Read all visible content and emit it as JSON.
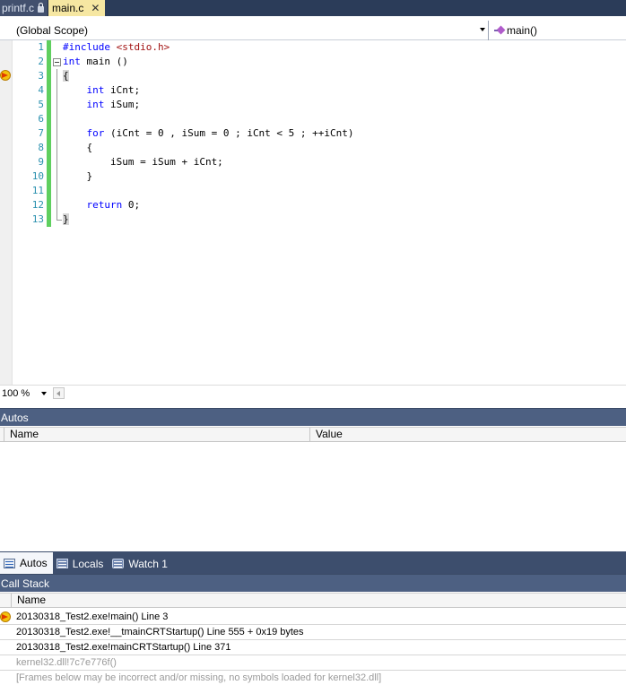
{
  "doc_tabs": [
    {
      "label": "printf.c",
      "locked": true,
      "active": false
    },
    {
      "label": "main.c",
      "active": true
    }
  ],
  "close_glyph": "✕",
  "nav_bar": {
    "scope": "(Global Scope)",
    "member": "main()"
  },
  "editor": {
    "line_numbers": [
      "1",
      "2",
      "3",
      "4",
      "5",
      "6",
      "7",
      "8",
      "9",
      "10",
      "11",
      "12",
      "13"
    ],
    "lines": [
      {
        "segments": [
          {
            "t": "#include ",
            "c": "pp"
          },
          {
            "t": "<stdio.h>",
            "c": "str"
          }
        ]
      },
      {
        "segments": [
          {
            "t": "int",
            "c": "kw"
          },
          {
            "t": " main ()",
            "c": ""
          }
        ]
      },
      {
        "segments": [
          {
            "t": "{",
            "c": "brace-hl"
          }
        ]
      },
      {
        "segments": [
          {
            "t": "    ",
            "c": ""
          },
          {
            "t": "int",
            "c": "kw"
          },
          {
            "t": " iCnt;",
            "c": ""
          }
        ]
      },
      {
        "segments": [
          {
            "t": "    ",
            "c": ""
          },
          {
            "t": "int",
            "c": "kw"
          },
          {
            "t": " iSum;",
            "c": ""
          }
        ]
      },
      {
        "segments": []
      },
      {
        "segments": [
          {
            "t": "    ",
            "c": ""
          },
          {
            "t": "for",
            "c": "kw"
          },
          {
            "t": " (iCnt = 0 , iSum = 0 ; iCnt < 5 ; ++iCnt)",
            "c": ""
          }
        ]
      },
      {
        "segments": [
          {
            "t": "    {",
            "c": ""
          }
        ]
      },
      {
        "segments": [
          {
            "t": "        iSum = iSum + iCnt;",
            "c": ""
          }
        ]
      },
      {
        "segments": [
          {
            "t": "    }",
            "c": ""
          }
        ]
      },
      {
        "segments": []
      },
      {
        "segments": [
          {
            "t": "    ",
            "c": ""
          },
          {
            "t": "return",
            "c": "kw"
          },
          {
            "t": " 0;",
            "c": ""
          }
        ]
      },
      {
        "segments": [
          {
            "t": "}",
            "c": "brace-hl"
          }
        ]
      }
    ],
    "current_line": "3"
  },
  "zoom": {
    "value": "100 %"
  },
  "autos_panel": {
    "title": "Autos",
    "columns": [
      "Name",
      "Value"
    ]
  },
  "bottom_tabs": [
    {
      "label": "Autos",
      "active": true
    },
    {
      "label": "Locals",
      "active": false
    },
    {
      "label": "Watch 1",
      "active": false
    }
  ],
  "call_stack": {
    "title": "Call Stack",
    "columns": [
      "Name"
    ],
    "rows": [
      {
        "text": "20130318_Test2.exe!main()  Line 3",
        "current": true,
        "grey": false
      },
      {
        "text": "20130318_Test2.exe!__tmainCRTStartup()  Line 555 + 0x19 bytes",
        "current": false,
        "grey": false
      },
      {
        "text": "20130318_Test2.exe!mainCRTStartup()  Line 371",
        "current": false,
        "grey": false
      },
      {
        "text": "kernel32.dll!7c7e776f()",
        "current": false,
        "grey": true
      },
      {
        "text": "[Frames below may be incorrect and/or missing, no symbols loaded for kernel32.dll]",
        "current": false,
        "grey": true
      }
    ]
  }
}
